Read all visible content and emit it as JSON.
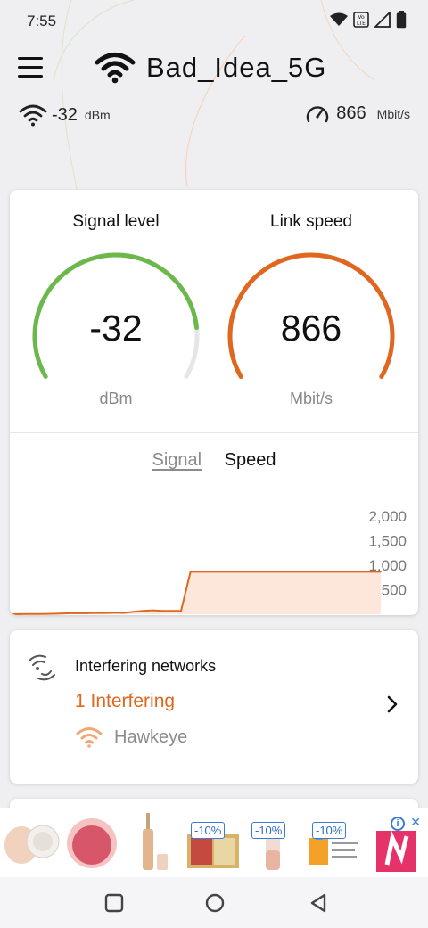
{
  "status_bar": {
    "time": "7:55",
    "icons": [
      "wifi-icon",
      "volte-icon",
      "signal-icon",
      "battery-icon"
    ]
  },
  "header": {
    "menu_icon": "menu-icon",
    "wifi_icon": "wifi-icon",
    "ssid": "Bad_Idea_5G",
    "signal_summary": {
      "value": "-32",
      "unit": "dBm"
    },
    "speed_summary": {
      "value": "866",
      "unit": "Mbit/s"
    }
  },
  "gauges": {
    "signal": {
      "title": "Signal level",
      "value": "-32",
      "unit": "dBm",
      "fraction": 0.85,
      "color": "#6cb84a"
    },
    "speed": {
      "title": "Link speed",
      "value": "866",
      "unit": "Mbit/s",
      "fraction": 1.0,
      "color": "#e0671f"
    }
  },
  "chart_tabs": {
    "signal": "Signal",
    "speed": "Speed",
    "active": "Speed"
  },
  "chart_data": {
    "type": "area",
    "series": [
      {
        "values": [
          0,
          2,
          5,
          5,
          8,
          10,
          18,
          22,
          20,
          28,
          26,
          30,
          28,
          50,
          70,
          80,
          70,
          70,
          70,
          866,
          866,
          866,
          866,
          866,
          866,
          866,
          866,
          866,
          866,
          866,
          866,
          866,
          866,
          866,
          866,
          866,
          866,
          866,
          866,
          866
        ]
      }
    ],
    "y_ticks": [
      "2,000",
      "1,500",
      "1,000",
      "500"
    ],
    "ylim": [
      0,
      2200
    ],
    "color": "#e0671f",
    "fill": "#fde7da"
  },
  "interfering": {
    "title": "Interfering networks",
    "count_label": "1 Interfering",
    "networks": [
      {
        "name": "Hawkeye",
        "icon": "wifi-icon"
      }
    ]
  },
  "ad": {
    "badges": [
      "-10%",
      "-10%",
      "-10%"
    ],
    "info_icon": "info-icon",
    "close_icon": "close-icon"
  },
  "nav": {
    "recent": "recent-apps-icon",
    "home": "home-icon",
    "back": "back-icon"
  }
}
